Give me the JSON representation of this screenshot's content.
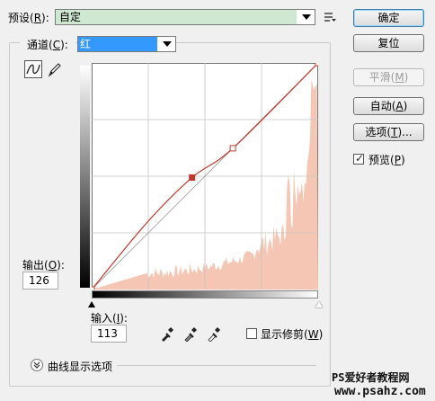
{
  "preset": {
    "label": "预设(",
    "key": "R",
    "label_end": "):",
    "value": "自定"
  },
  "buttons": {
    "ok": "确定",
    "reset": "复位",
    "smooth_pre": "平滑(",
    "smooth_key": "M",
    "smooth_post": ")",
    "auto_pre": "自动(",
    "auto_key": "A",
    "auto_post": ")",
    "options_pre": "选项(",
    "options_key": "T",
    "options_post": ")..."
  },
  "preview": {
    "label_pre": "预览(",
    "key": "P",
    "label_post": ")",
    "checked": true
  },
  "channel": {
    "label_pre": "通道(",
    "key": "C",
    "label_post": "):",
    "value": "红"
  },
  "output": {
    "label_pre": "输出(",
    "key": "O",
    "label_post": "):",
    "value": "126"
  },
  "input": {
    "label_pre": "输入(",
    "key": "I",
    "label_post": "):",
    "value": "113"
  },
  "show_clipping": {
    "label_pre": "显示修剪(",
    "key": "W",
    "label_post": ")",
    "checked": false
  },
  "curve_options": {
    "label": "曲线显示选项"
  },
  "watermark": {
    "line1": "PS爱好者教程网",
    "line2": "www.psahz.com"
  },
  "curve": {
    "channel_color": "#c0392b",
    "histogram_color": "#f5c6b3",
    "control_points": [
      {
        "input": 0,
        "output": 0
      },
      {
        "input": 113,
        "output": 126
      },
      {
        "input": 159,
        "output": 159
      },
      {
        "input": 255,
        "output": 255
      }
    ]
  }
}
